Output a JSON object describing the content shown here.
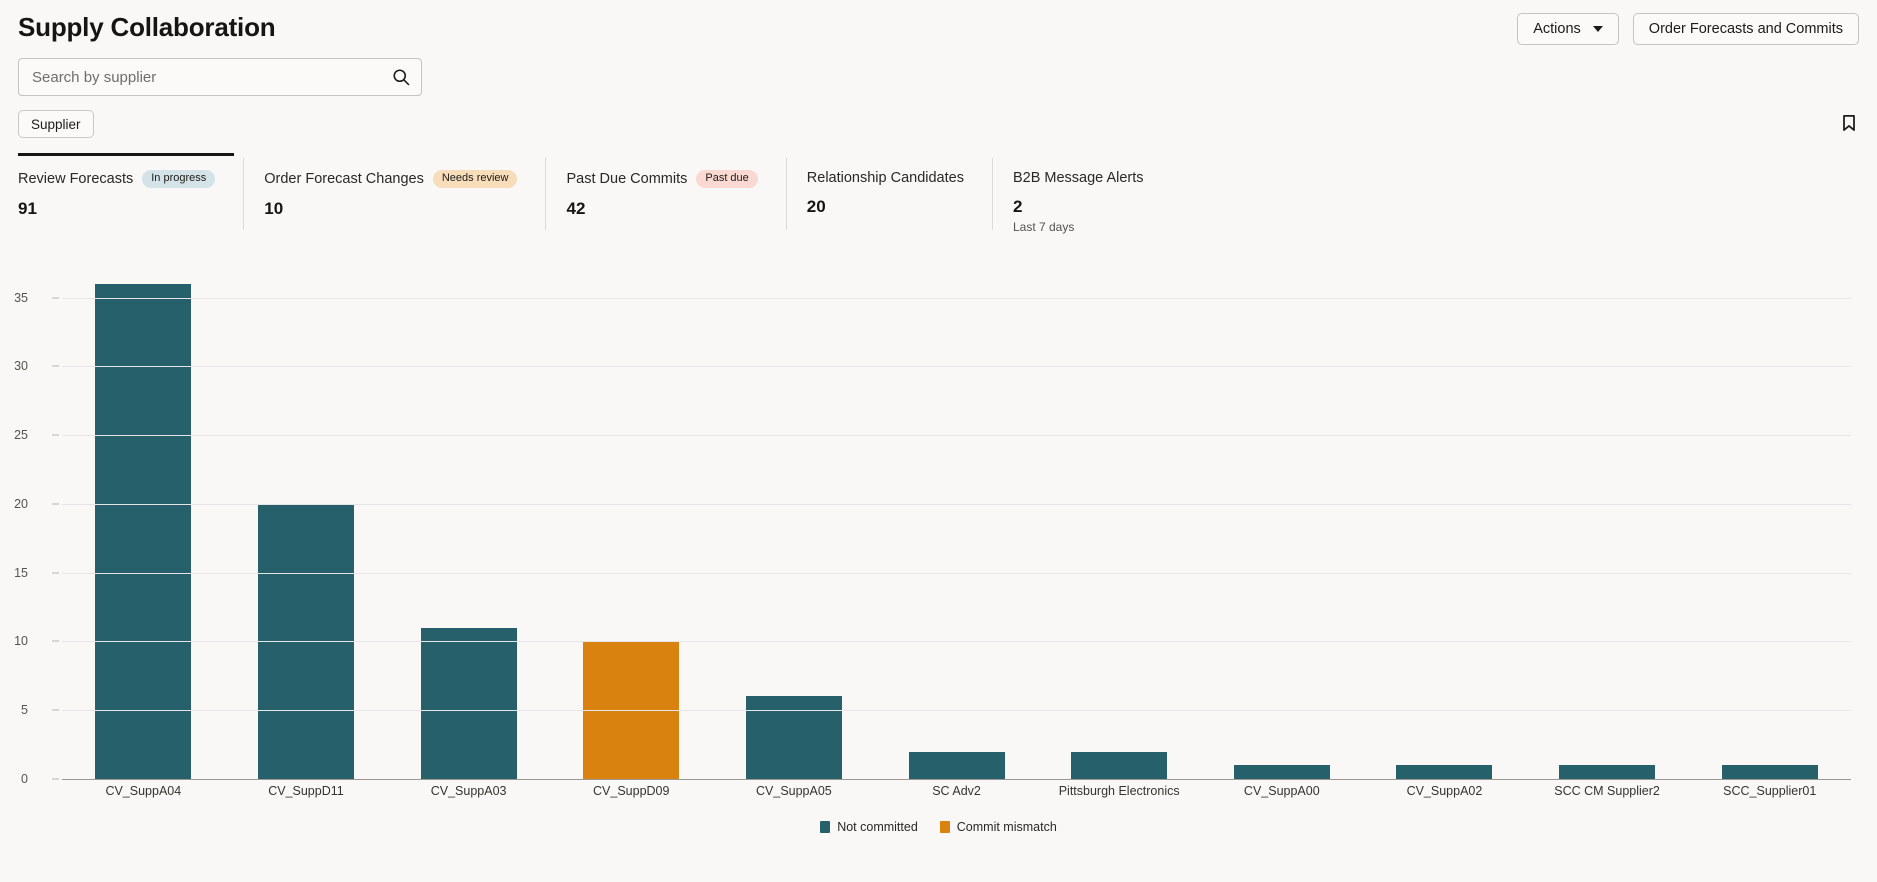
{
  "header": {
    "title": "Supply Collaboration",
    "actions_label": "Actions",
    "order_forecasts_label": "Order Forecasts and Commits"
  },
  "search": {
    "placeholder": "Search by supplier",
    "value": "",
    "icon": "search-icon"
  },
  "filters": {
    "chip_label": "Supplier",
    "bookmark_icon": "bookmark-icon"
  },
  "kpis": [
    {
      "label": "Review Forecasts",
      "badge": "In progress",
      "badge_color": "#d4e3e8",
      "value": "91",
      "sub": "",
      "active": true
    },
    {
      "label": "Order Forecast Changes",
      "badge": "Needs review",
      "badge_color": "#f7ddb9",
      "value": "10",
      "sub": "",
      "active": false
    },
    {
      "label": "Past Due Commits",
      "badge": "Past due",
      "badge_color": "#fbd9d3",
      "value": "42",
      "sub": "",
      "active": false
    },
    {
      "label": "Relationship Candidates",
      "badge": "",
      "badge_color": "",
      "value": "20",
      "sub": "",
      "active": false
    },
    {
      "label": "B2B Message Alerts",
      "badge": "",
      "badge_color": "",
      "value": "2",
      "sub": "Last 7 days",
      "active": false
    }
  ],
  "chart_data": {
    "type": "bar",
    "title": "",
    "xlabel": "",
    "ylabel": "",
    "ylim": [
      0,
      37
    ],
    "yticks": [
      0,
      5,
      10,
      15,
      20,
      25,
      30,
      35
    ],
    "grid": true,
    "legend_position": "bottom",
    "categories": [
      "CV_SuppA04",
      "CV_SuppD11",
      "CV_SuppA03",
      "CV_SuppD09",
      "CV_SuppA05",
      "SC Adv2",
      "Pittsburgh Electronics",
      "CV_SuppA00",
      "CV_SuppA02",
      "SCC CM Supplier2",
      "SCC_Supplier01"
    ],
    "values": [
      36,
      20,
      11,
      10,
      6,
      2,
      2,
      1,
      1,
      1,
      1
    ],
    "bar_series": [
      "Not committed",
      "Not committed",
      "Not committed",
      "Commit mismatch",
      "Not committed",
      "Not committed",
      "Not committed",
      "Not committed",
      "Not committed",
      "Not committed",
      "Not committed"
    ],
    "legend": [
      {
        "name": "Not committed",
        "color": "#26606b"
      },
      {
        "name": "Commit mismatch",
        "color": "#d9820f"
      }
    ]
  }
}
